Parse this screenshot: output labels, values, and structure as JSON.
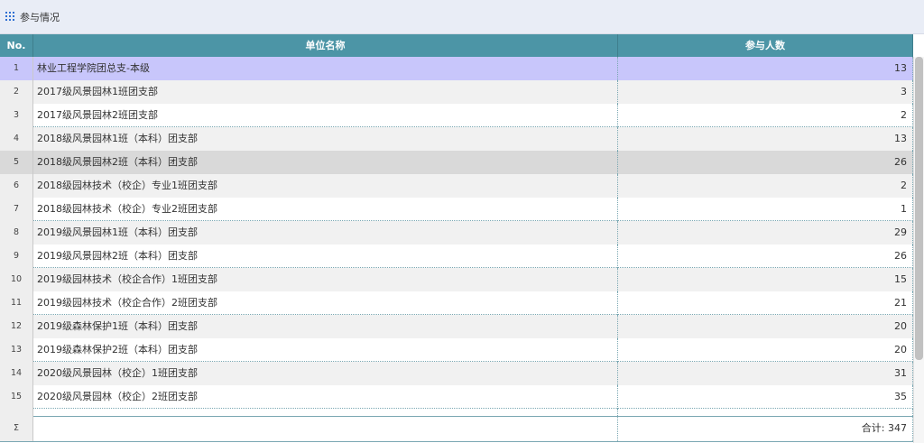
{
  "header": {
    "title": "参与情况",
    "icon": "grid-icon"
  },
  "table": {
    "columns": {
      "no": "No.",
      "name": "单位名称",
      "count": "参与人数"
    },
    "rows": [
      {
        "no": "1",
        "name": "林业工程学院团总支-本级",
        "count": "13"
      },
      {
        "no": "2",
        "name": "2017级风景园林1班团支部",
        "count": "3"
      },
      {
        "no": "3",
        "name": "2017级风景园林2班团支部",
        "count": "2"
      },
      {
        "no": "4",
        "name": "2018级风景园林1班（本科）团支部",
        "count": "13"
      },
      {
        "no": "5",
        "name": "2018级风景园林2班（本科）团支部",
        "count": "26"
      },
      {
        "no": "6",
        "name": "2018级园林技术（校企）专业1班团支部",
        "count": "2"
      },
      {
        "no": "7",
        "name": "2018级园林技术（校企）专业2班团支部",
        "count": "1"
      },
      {
        "no": "8",
        "name": "2019级风景园林1班（本科）团支部",
        "count": "29"
      },
      {
        "no": "9",
        "name": "2019级风景园林2班（本科）团支部",
        "count": "26"
      },
      {
        "no": "10",
        "name": "2019级园林技术（校企合作）1班团支部",
        "count": "15"
      },
      {
        "no": "11",
        "name": "2019级园林技术（校企合作）2班团支部",
        "count": "21"
      },
      {
        "no": "12",
        "name": "2019级森林保护1班（本科）团支部",
        "count": "20"
      },
      {
        "no": "13",
        "name": "2019级森林保护2班（本科）团支部",
        "count": "20"
      },
      {
        "no": "14",
        "name": "2020级风景园林（校企）1班团支部",
        "count": "31"
      },
      {
        "no": "15",
        "name": "2020级风景园林（校企）2班团支部",
        "count": "35"
      }
    ],
    "footer": {
      "no": "Σ",
      "total": "合计: 347"
    }
  },
  "colors": {
    "header_bar": "#4c95a6",
    "selected_row": "#c8c6fb",
    "hover_row": "#d9d9d9",
    "icon": "#2f6fd2"
  }
}
